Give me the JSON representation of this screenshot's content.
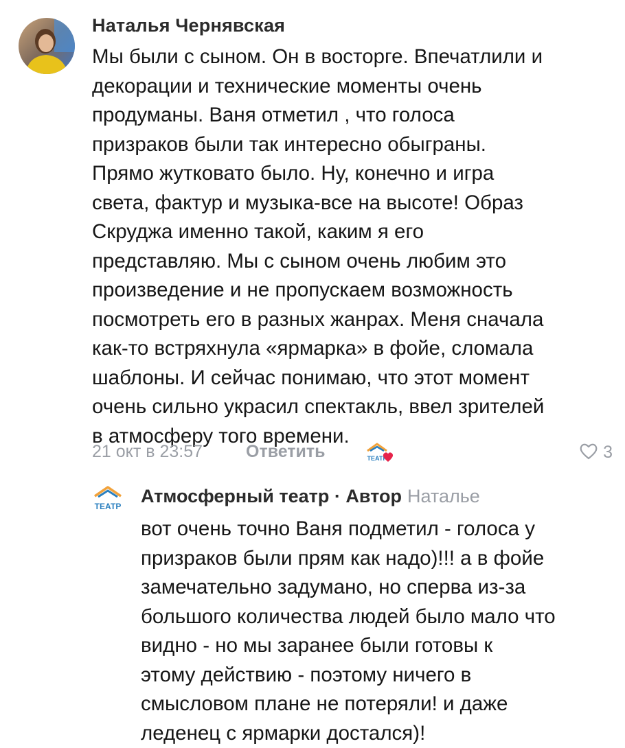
{
  "comment": {
    "author": "Наталья Чернявская",
    "text_lines": [
      "Мы были с сыном. Он в восторге. Впечатлили и",
      "декорации и технические моменты очень",
      "продуманы. Ваня отметил , что голоса",
      "призраков были так интересно обыграны.",
      "Прямо жутковато было. Ну, конечно и игра",
      "света, фактур и музыка-все на высоте! Образ",
      "Скруджа именно такой, каким я его",
      "представляю. Мы с сыном очень любим это",
      "произведение и не пропускаем возможность",
      "посмотреть его в разных жанрах. Меня сначала",
      "как-то встряхнула «ярмарка» в фойе, сломала",
      "шаблоны. И сейчас понимаю, что этот момент",
      "очень сильно украсил спектакль, ввел зрителей",
      "в атмосферу того времени."
    ],
    "date": "21 окт в 23:57",
    "reply_label": "Ответить",
    "like_count": "3",
    "author_liked": true
  },
  "reply": {
    "author": "Атмосферный театр",
    "separator": " · ",
    "role": "Автор",
    "reply_to": "Наталье",
    "logo_text": "ТЕАТР",
    "text_lines": [
      "вот очень точно Ваня подметил - голоса у",
      "призраков были прям как надо)!!! а в фойе",
      "замечательно задумано, но сперва из-за",
      "большого количества людей было мало что",
      "видно - но мы заранее были готовы к",
      "этому действию - поэтому ничего в",
      "смысловом плане не потеряли! и даже",
      "леденец с ярмарки достался)!"
    ]
  },
  "colors": {
    "text": "#161616",
    "muted": "#9a9ea5",
    "heart": "#e6244b",
    "logo_orange": "#f2a23a",
    "logo_blue": "#2a7fbf"
  },
  "icons": {
    "like": "heart-outline-icon",
    "author_like": "theater-logo-with-heart-icon"
  }
}
